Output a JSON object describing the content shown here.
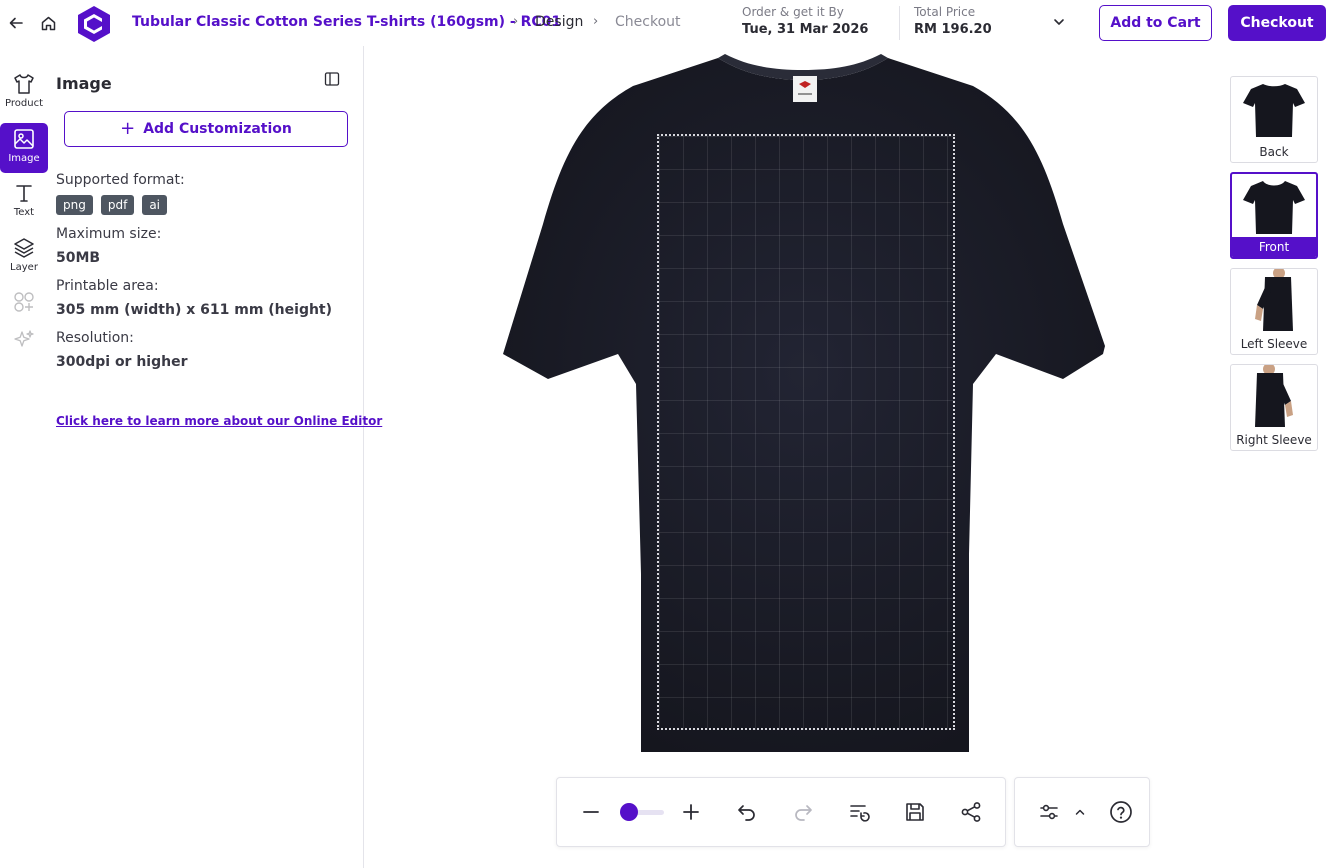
{
  "header": {
    "product_title": "Tubular Classic Cotton Series T-shirts (160gsm) - RC01",
    "breadcrumb_design": "Design",
    "breadcrumb_checkout": "Checkout",
    "order_label": "Order & get it By",
    "order_date": "Tue, 31 Mar 2026",
    "price_label": "Total Price",
    "price_value": "RM 196.20",
    "add_to_cart": "Add to Cart",
    "checkout": "Checkout"
  },
  "rail": {
    "product": "Product",
    "image": "Image",
    "text": "Text",
    "layer": "Layer"
  },
  "panel": {
    "title": "Image",
    "add_customization": "Add Customization",
    "format_label": "Supported format:",
    "formats": [
      "png",
      "pdf",
      "ai"
    ],
    "max_size_label": "Maximum size:",
    "max_size_value": "50MB",
    "printable_label": "Printable area:",
    "printable_value": "305 mm (width) x 611 mm (height)",
    "resolution_label": "Resolution:",
    "resolution_value": "300dpi or higher",
    "learn_more": "Click here to learn more about our Online Editor"
  },
  "views": [
    {
      "label": "Back",
      "active": false
    },
    {
      "label": "Front",
      "active": true
    },
    {
      "label": "Left Sleeve",
      "active": false
    },
    {
      "label": "Right Sleeve",
      "active": false
    }
  ],
  "colors": {
    "brand": "#5510c9",
    "shirt": "#1d1e27"
  }
}
